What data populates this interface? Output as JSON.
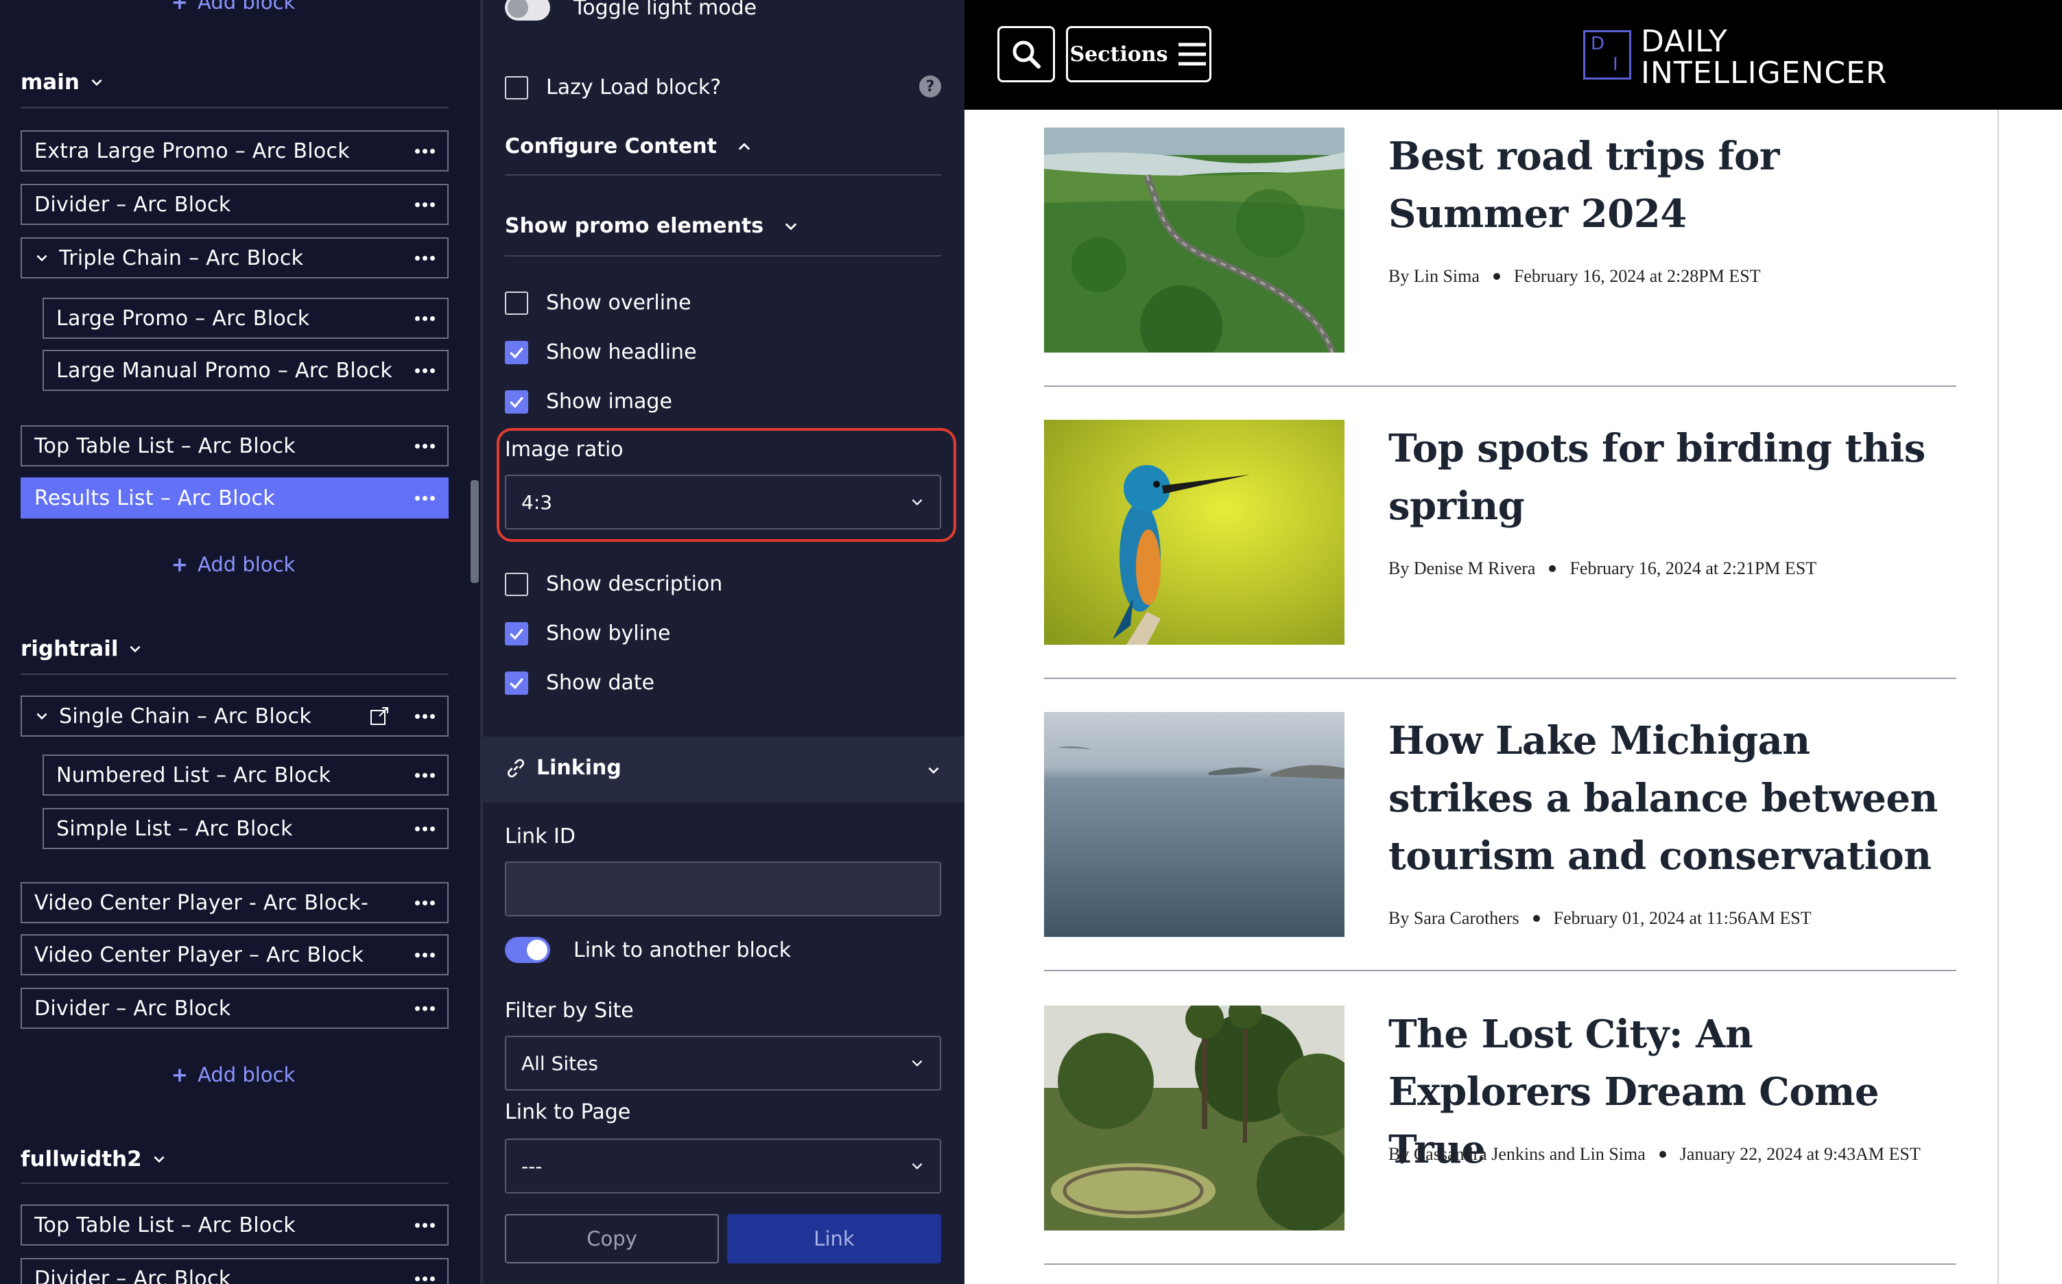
{
  "left_panel": {
    "add_block_label": "Add block",
    "sections": [
      {
        "name": "main"
      },
      {
        "name": "rightrail"
      },
      {
        "name": "fullwidth2"
      }
    ],
    "blocks": {
      "main": [
        "Extra Large Promo – Arc Block",
        "Divider – Arc Block",
        "Triple Chain – Arc Block",
        "Large Promo – Arc Block",
        "Large Manual Promo – Arc Block",
        "Top Table List – Arc Block",
        "Results List – Arc Block"
      ],
      "rightrail": [
        "Single Chain – Arc Block",
        "Numbered List – Arc Block",
        "Simple List – Arc Block",
        "Video Center Player - Arc Block-",
        "Video Center Player – Arc Block",
        "Divider – Arc Block"
      ],
      "fullwidth2": [
        "Top Table List – Arc Block",
        "Divider – Arc Block"
      ]
    }
  },
  "settings_panel": {
    "toggle_light_mode": "Toggle light mode",
    "lazy_load": "Lazy Load block?",
    "help_icon": "?",
    "configure_content": "Configure Content",
    "show_promo_elements": "Show promo elements",
    "checkboxes": [
      {
        "label": "Show overline",
        "checked": false
      },
      {
        "label": "Show headline",
        "checked": true
      },
      {
        "label": "Show image",
        "checked": true
      },
      {
        "label": "Show description",
        "checked": false
      },
      {
        "label": "Show byline",
        "checked": true
      },
      {
        "label": "Show date",
        "checked": true
      }
    ],
    "image_ratio_label": "Image ratio",
    "image_ratio_value": "4:3",
    "linking": "Linking",
    "link_id_label": "Link ID",
    "link_id_value": "",
    "link_to_another_block": "Link to another block",
    "filter_by_site_label": "Filter by Site",
    "filter_by_site_value": "All Sites",
    "link_to_page_label": "Link to Page",
    "link_to_page_value": "---",
    "copy_button": "Copy",
    "link_button": "Link",
    "accent_color": "#6a78f2",
    "highlight_color": "#e23b2e"
  },
  "preview": {
    "sections_button": "Sections",
    "logo_line1": "DAILY",
    "logo_line2": "INTELLIGENCER",
    "logo_mark_letters": [
      "D",
      "I"
    ],
    "articles": [
      {
        "headline": "Best road trips for Summer 2024",
        "author": "By Lin Sima",
        "date": "February 16, 2024 at 2:28PM EST",
        "image": "winding-road-photo"
      },
      {
        "headline": "Top spots for birding this spring",
        "author": "By Denise M Rivera",
        "date": "February 16, 2024 at 2:21PM EST",
        "image": "kingfisher-photo"
      },
      {
        "headline": "How Lake Michigan strikes a balance between tourism and conservation",
        "author": "By Sara Carothers",
        "date": "February 01, 2024 at 11:56AM EST",
        "image": "lake-photo"
      },
      {
        "headline": "The Lost City: An Explorers Dream Come True",
        "author": "By Cassandra Jenkins and Lin Sima",
        "date": "January 22, 2024 at 9:43AM EST",
        "image": "jungle-ruins-photo"
      }
    ]
  }
}
